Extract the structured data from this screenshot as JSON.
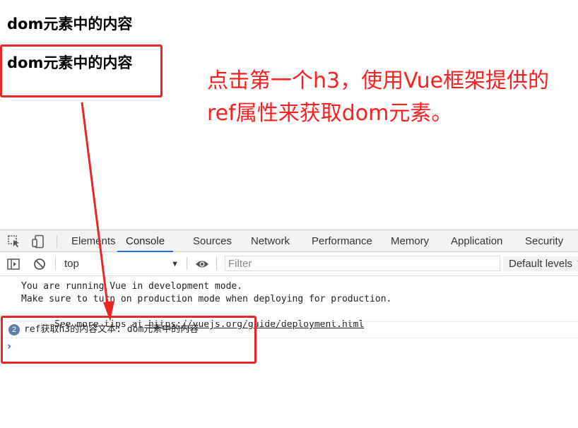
{
  "page": {
    "h3_first": "dom元素中的内容",
    "h3_second": "dom元素中的内容",
    "annotation": "点击第一个h3，使用Vue框架提供的ref属性来获取dom元素。"
  },
  "devtools": {
    "tabs": [
      "Elements",
      "Console",
      "Sources",
      "Network",
      "Performance",
      "Memory",
      "Application",
      "Security"
    ],
    "active_tab": "Console",
    "context": "top",
    "filter_placeholder": "Filter",
    "levels": "Default levels ▼",
    "log": {
      "line1": "You are running Vue in development mode.",
      "line2": "Make sure to turn on production mode when deploying for production.",
      "line3_prefix": "See more tips at ",
      "line3_link": "https://vuejs.org/guide/deployment.html",
      "ref_count": "2",
      "ref_message": "ref获取h3的内容文本: dom元素中的内容",
      "prompt": "›"
    }
  },
  "colors": {
    "annotation_red": "#e8262a",
    "active_tab_blue": "#1a73e8"
  },
  "icons": [
    "inspect-icon",
    "device-toggle-icon",
    "sidebar-toggle-icon",
    "clear-console-icon",
    "eye-icon",
    "dropdown-caret-icon"
  ]
}
